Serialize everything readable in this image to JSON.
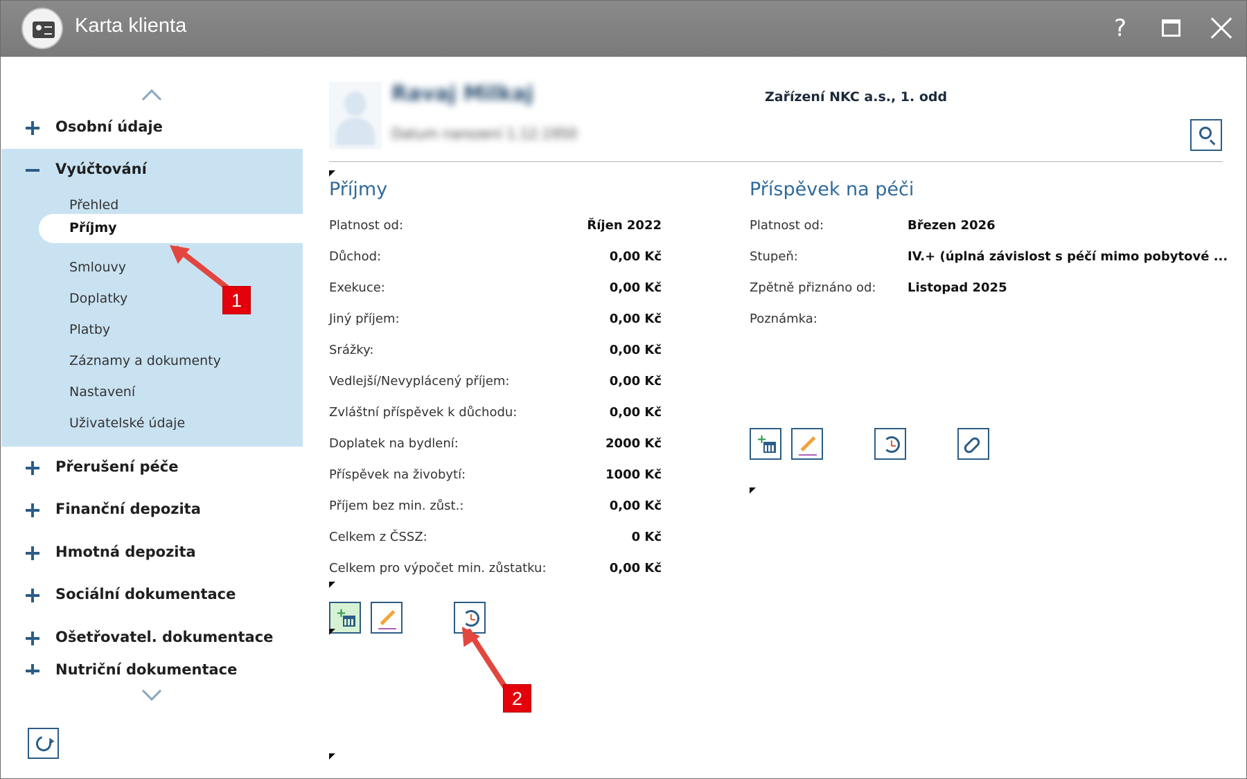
{
  "window": {
    "title": "Karta klienta",
    "help_label": "?"
  },
  "sidebar": {
    "sections_top": [
      {
        "label": "Osobní údaje",
        "state": "collapsed"
      }
    ],
    "active_section": {
      "label": "Vyúčtování",
      "state": "expanded",
      "items": [
        {
          "label": "Přehled"
        },
        {
          "label": "Příjmy",
          "active": true
        },
        {
          "label": "Smlouvy"
        },
        {
          "label": "Doplatky"
        },
        {
          "label": "Platby"
        },
        {
          "label": "Záznamy a dokumenty"
        },
        {
          "label": "Nastavení"
        },
        {
          "label": "Uživatelské údaje"
        }
      ]
    },
    "sections_bottom": [
      {
        "label": "Přerušení péče"
      },
      {
        "label": "Finanční depozita"
      },
      {
        "label": "Hmotná depozita"
      },
      {
        "label": "Sociální dokumentace"
      },
      {
        "label": "Ošetřovatel. dokumentace"
      },
      {
        "label": "Nutriční dokumentace"
      }
    ]
  },
  "header": {
    "client_name": "Ravaj Milkaj",
    "client_sub": "Datum narození 1.12.1950",
    "facility": "Zařízení NKC a.s., 1. odd"
  },
  "income": {
    "title": "Příjmy",
    "rows": [
      {
        "label": "Platnost od:",
        "value": "Říjen 2022"
      },
      {
        "label": "Důchod:",
        "value": "0,00 Kč"
      },
      {
        "label": "Exekuce:",
        "value": "0,00 Kč"
      },
      {
        "label": "Jiný příjem:",
        "value": "0,00 Kč"
      },
      {
        "label": "Srážky:",
        "value": "0,00 Kč"
      },
      {
        "label": "Vedlejší/Nevyplácený příjem:",
        "value": "0,00 Kč"
      },
      {
        "label": "Zvláštní příspěvek k důchodu:",
        "value": "0,00 Kč"
      },
      {
        "label": "Doplatek na bydlení:",
        "value": "2000 Kč"
      },
      {
        "label": "Příspěvek na živobytí:",
        "value": "1000 Kč"
      },
      {
        "label": "Příjem bez min. zůst.:",
        "value": "0,00 Kč"
      },
      {
        "label": "Celkem z ČSSZ:",
        "value": "0 Kč"
      },
      {
        "label": "Celkem pro výpočet min. zůstatku:",
        "value": "0,00 Kč"
      }
    ]
  },
  "care_allowance": {
    "title": "Příspěvek na péči",
    "rows": [
      {
        "label": "Platnost od:",
        "value": "Březen 2026"
      },
      {
        "label": "Stupeň:",
        "value": "IV.+ (úplná závislost s péčí mimo pobytové ..."
      },
      {
        "label": "Zpětně přiznáno od:",
        "value": "Listopad 2025"
      },
      {
        "label": "Poznámka:",
        "value": ""
      }
    ]
  },
  "annotations": [
    {
      "number": "1"
    },
    {
      "number": "2"
    }
  ],
  "colors": {
    "accent": "#2b5c86",
    "sidebar_active": "#c9e2f2",
    "section_title": "#2f6a9b",
    "annotation_red": "#e3000b"
  }
}
